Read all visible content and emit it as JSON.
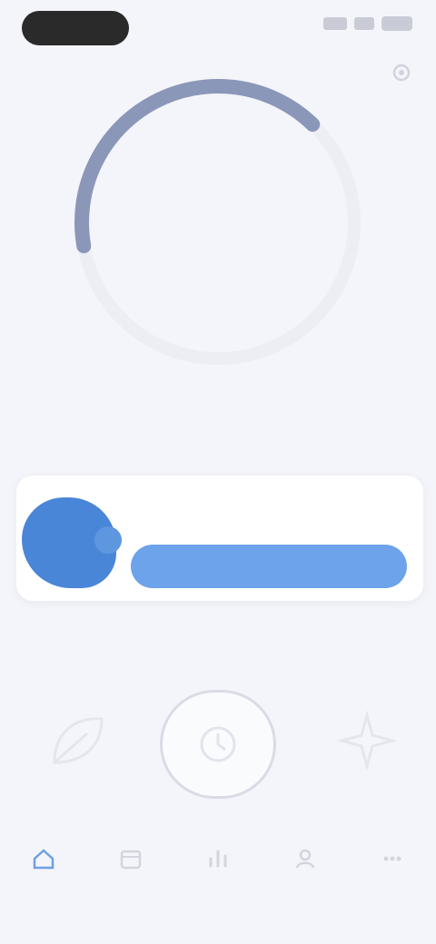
{
  "status_bar": {
    "time": "",
    "icons": [
      "signal-icon",
      "wifi-icon",
      "battery-icon"
    ]
  },
  "header": {
    "settings_icon": "gear-icon"
  },
  "timer": {
    "title": "",
    "value": "",
    "subtitle": "",
    "progress": 0.4,
    "ring_color": "#8b97b8",
    "track_color": "#eceef4"
  },
  "section_label_top": "",
  "session": {
    "label": "",
    "sublabel": "",
    "action_label": "",
    "accent": "#6da3ea",
    "avatar_color": "#4a86d8"
  },
  "section_label_bottom": "",
  "modes": [
    {
      "icon": "leaf-icon",
      "label": ""
    },
    {
      "icon": "circle-timer-icon",
      "label": ""
    },
    {
      "icon": "sparkle-icon",
      "label": ""
    }
  ],
  "bottom_nav": [
    {
      "icon": "home-icon",
      "label": "",
      "active": true
    },
    {
      "icon": "calendar-icon",
      "label": ""
    },
    {
      "icon": "chart-icon",
      "label": ""
    },
    {
      "icon": "person-icon",
      "label": ""
    },
    {
      "icon": "more-icon",
      "label": ""
    }
  ]
}
